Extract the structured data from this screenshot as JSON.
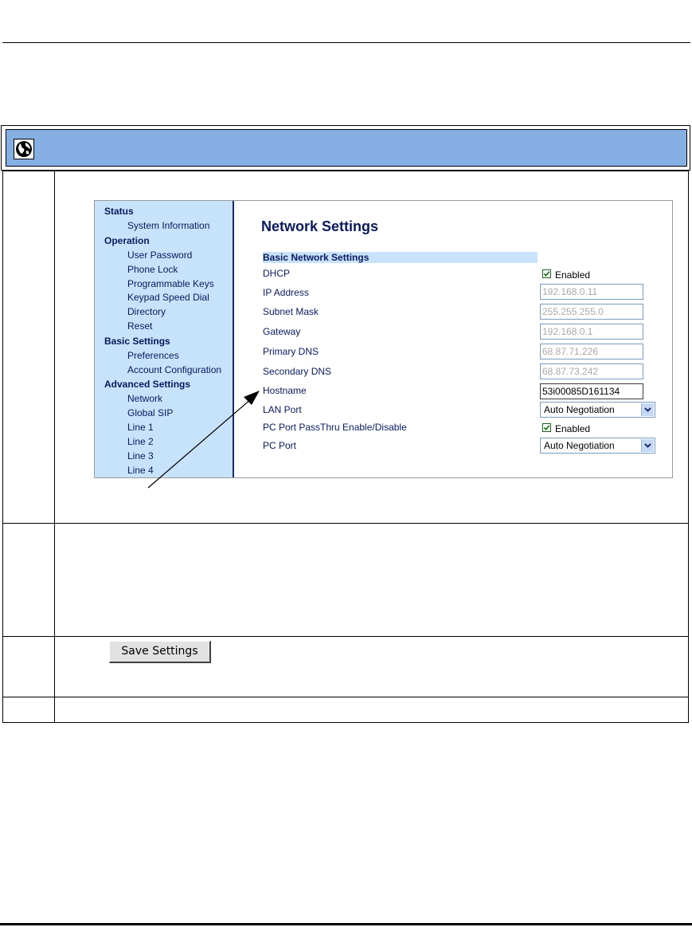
{
  "icons": {
    "header_icon": "globe-icon"
  },
  "colors": {
    "header_band": "#86b0e4",
    "sidebar_bg": "#c7e2fb",
    "nav_text": "#0a1a5c"
  },
  "sidebar": {
    "sections": [
      {
        "heading": "Status",
        "items": [
          "System Information"
        ]
      },
      {
        "heading": "Operation",
        "items": [
          "User Password",
          "Phone Lock",
          "Programmable Keys",
          "Keypad Speed Dial",
          "Directory",
          "Reset"
        ]
      },
      {
        "heading": "Basic Settings",
        "items": [
          "Preferences",
          "Account Configuration"
        ]
      },
      {
        "heading": "Advanced Settings",
        "items": [
          "Network",
          "Global SIP",
          "Line 1",
          "Line 2",
          "Line 3",
          "Line 4"
        ]
      }
    ]
  },
  "main": {
    "title": "Network Settings",
    "section": "Basic Network Settings",
    "fields": {
      "dhcp": {
        "label": "DHCP",
        "checked": true,
        "check_label": "Enabled"
      },
      "ip": {
        "label": "IP Address",
        "value": "192.168.0.11"
      },
      "subnet": {
        "label": "Subnet Mask",
        "value": "255.255.255.0"
      },
      "gateway": {
        "label": "Gateway",
        "value": "192.168.0.1"
      },
      "pdns": {
        "label": "Primary DNS",
        "value": "68.87.71.226"
      },
      "sdns": {
        "label": "Secondary DNS",
        "value": "68.87.73.242"
      },
      "hostname": {
        "label": "Hostname",
        "value": "53i00085D161134"
      },
      "lan": {
        "label": "LAN Port",
        "value": "Auto Negotiation"
      },
      "passthru": {
        "label": "PC Port PassThru Enable/Disable",
        "checked": true,
        "check_label": "Enabled"
      },
      "pcport": {
        "label": "PC Port",
        "value": "Auto Negotiation"
      }
    }
  },
  "save_button": {
    "label": "Save Settings"
  }
}
